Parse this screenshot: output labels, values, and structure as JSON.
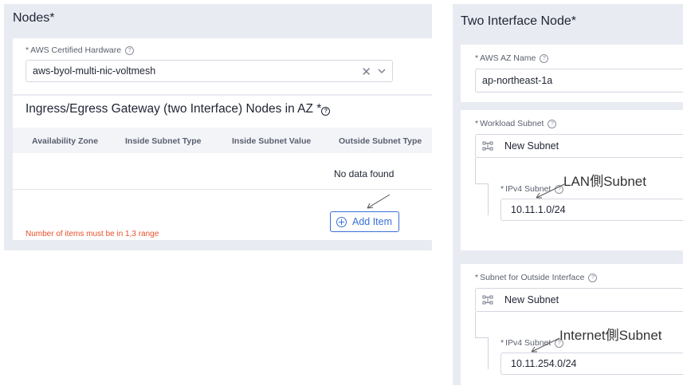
{
  "left": {
    "title": "Nodes",
    "required_mark": "*",
    "hardware": {
      "label": "AWS Certified Hardware",
      "value": "aws-byol-multi-nic-voltmesh"
    },
    "gateway": {
      "title": "Ingress/Egress Gateway (two Interface) Nodes in AZ",
      "columns": [
        "Availability Zone",
        "Inside Subnet Type",
        "Inside Subnet Value",
        "Outside Subnet Type"
      ],
      "empty_text": "No data found",
      "add_label": "Add Item",
      "error": "Number of items must be in 1,3 range"
    }
  },
  "right": {
    "title": "Two Interface Node",
    "az": {
      "label": "AWS AZ Name",
      "value": "ap-northeast-1a"
    },
    "workload": {
      "label": "Workload Subnet",
      "choice": "New Subnet",
      "ipv4_label": "IPv4 Subnet",
      "ipv4_value": "10.11.1.0/24",
      "annotation": "LAN側Subnet"
    },
    "outside": {
      "label": "Subnet for Outside Interface",
      "choice": "New Subnet",
      "ipv4_label": "IPv4 Subnet",
      "ipv4_value": "10.11.254.0/24",
      "annotation": "Internet側Subnet"
    }
  },
  "colors": {
    "panel": "#e8ebf2",
    "accent": "#3a6fd8",
    "error": "#e8502a"
  },
  "icons": [
    "help-icon",
    "clear-icon",
    "chevron-down-icon",
    "plus-circle-icon",
    "subnet-icon",
    "arrow-annotation"
  ]
}
